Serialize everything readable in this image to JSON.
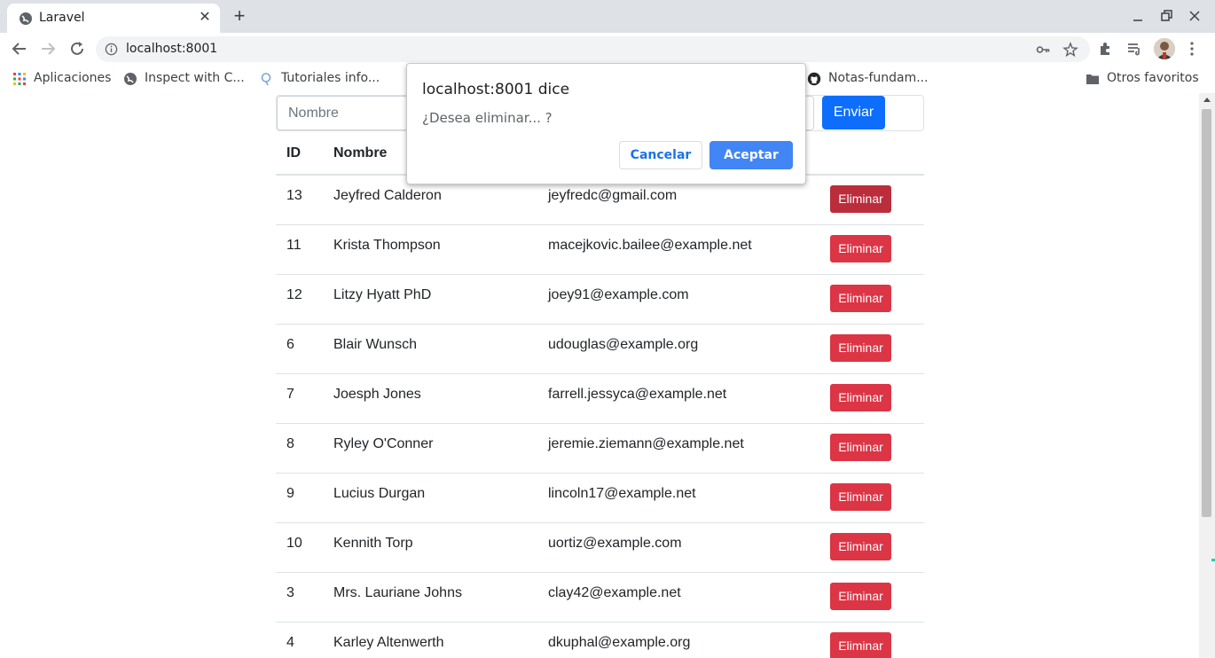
{
  "browser": {
    "tab_title": "Laravel",
    "url": "localhost:8001",
    "bookmarks": [
      {
        "label": "Aplicaciones",
        "icon": "apps-grid-icon"
      },
      {
        "label": "Inspect with C...",
        "icon": "globe-icon"
      },
      {
        "label": "Tutoriales info...",
        "icon": "search-bubble-icon"
      },
      {
        "label": "Notas-fundam...",
        "icon": "github-icon"
      }
    ],
    "other_bookmarks": "Otros favoritos"
  },
  "form": {
    "nombre_placeholder": "Nombre",
    "submit_label": "Enviar"
  },
  "table": {
    "headers": {
      "id": "ID",
      "name": "Nombre"
    },
    "delete_label": "Eliminar",
    "rows": [
      {
        "id": "13",
        "name": "Jeyfred Calderon",
        "email": "jeyfredc@gmail.com"
      },
      {
        "id": "11",
        "name": "Krista Thompson",
        "email": "macejkovic.bailee@example.net"
      },
      {
        "id": "12",
        "name": "Litzy Hyatt PhD",
        "email": "joey91@example.com"
      },
      {
        "id": "6",
        "name": "Blair Wunsch",
        "email": "udouglas@example.org"
      },
      {
        "id": "7",
        "name": "Joesph Jones",
        "email": "farrell.jessyca@example.net"
      },
      {
        "id": "8",
        "name": "Ryley O'Conner",
        "email": "jeremie.ziemann@example.net"
      },
      {
        "id": "9",
        "name": "Lucius Durgan",
        "email": "lincoln17@example.net"
      },
      {
        "id": "10",
        "name": "Kennith Torp",
        "email": "uortiz@example.com"
      },
      {
        "id": "3",
        "name": "Mrs. Lauriane Johns",
        "email": "clay42@example.net"
      },
      {
        "id": "4",
        "name": "Karley Altenwerth",
        "email": "dkuphal@example.org"
      }
    ]
  },
  "dialog": {
    "title": "localhost:8001 dice",
    "message": "¿Desea eliminar... ?",
    "cancel_label": "Cancelar",
    "ok_label": "Aceptar"
  },
  "colors": {
    "danger": "#dc3545",
    "primary": "#0d6efd",
    "dialog_ok": "#4285f4"
  }
}
